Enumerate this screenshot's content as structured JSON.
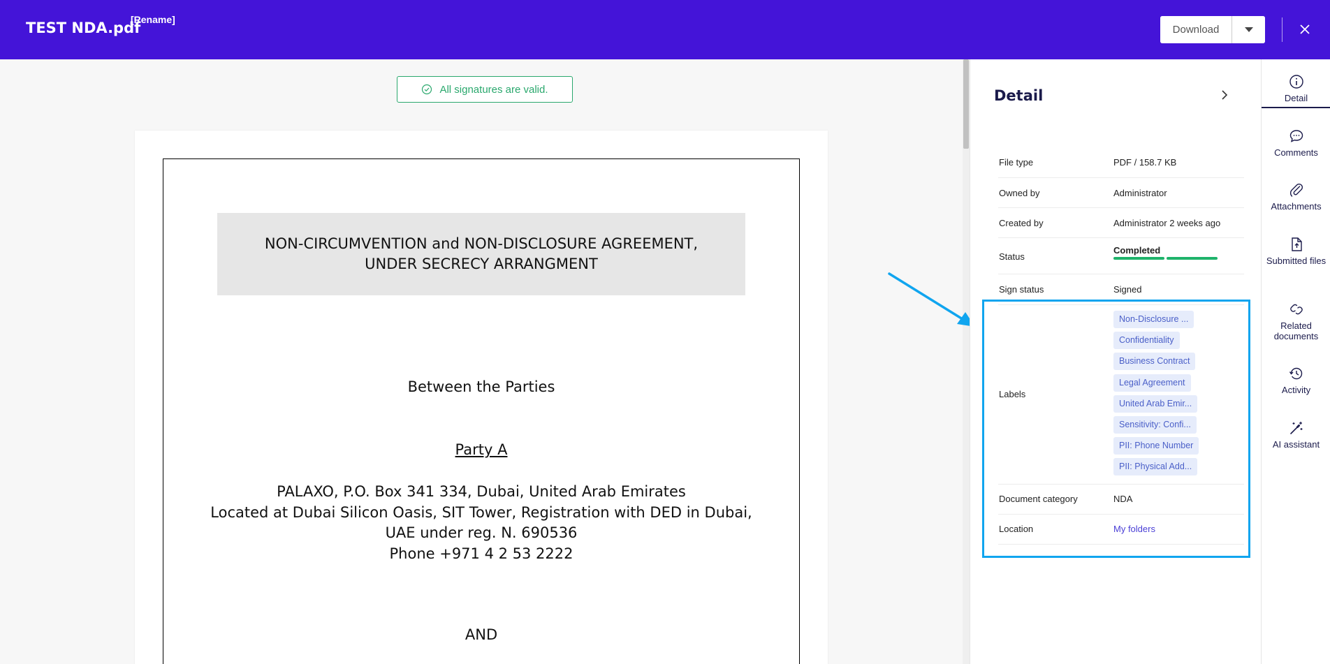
{
  "header": {
    "file_title": "TEST NDA.pdf",
    "rename_label": "[Rename]",
    "download_label": "Download"
  },
  "viewer": {
    "valid_badge": "All signatures are valid.",
    "document": {
      "title_line1": "NON-CIRCUMVENTION and NON-DISCLOSURE AGREEMENT,",
      "title_line2": "UNDER SECRECY ARRANGMENT",
      "between": "Between the Parties",
      "party_a": "Party A",
      "address_lines": [
        "PALAXO, P.O. Box 341 334, Dubai, United Arab Emirates",
        "Located at Dubai Silicon Oasis, SIT Tower, Registration with DED in Dubai,",
        "UAE under reg. N. 690536",
        "Phone  +971 4 2 53 2222"
      ],
      "and": "AND"
    }
  },
  "detail": {
    "title": "Detail",
    "rows": [
      {
        "key": "File type",
        "value": "PDF / 158.7 KB"
      },
      {
        "key": "Owned by",
        "value": "Administrator"
      },
      {
        "key": "Created by",
        "value": "Administrator 2 weeks ago"
      },
      {
        "key": "Status",
        "value": "Completed",
        "progress": 1.0
      },
      {
        "key": "Sign status",
        "value": "Signed"
      },
      {
        "key": "Labels"
      },
      {
        "key": "Document category",
        "value": "NDA"
      },
      {
        "key": "Location",
        "value": "My folders"
      }
    ],
    "labels": [
      "Non-Disclosure ...",
      "Confidentiality",
      "Business Contract",
      "Legal Agreement",
      "United Arab Emir...",
      "Sensitivity: Confi...",
      "PII: Phone Number",
      "PII: Physical Add..."
    ]
  },
  "rail": [
    {
      "label": "Detail",
      "icon": "info-icon"
    },
    {
      "label": "Comments",
      "icon": "comment-icon"
    },
    {
      "label": "Attachments",
      "icon": "paperclip-icon"
    },
    {
      "label": "Submitted files",
      "icon": "file-upload-icon"
    },
    {
      "label": "Related documents",
      "icon": "link-icon"
    },
    {
      "label": "Activity",
      "icon": "history-icon"
    },
    {
      "label": "AI assistant",
      "icon": "magic-wand-icon"
    }
  ],
  "colors": {
    "header_bg": "#4414d8",
    "valid_green": "#2aa86d",
    "highlight_blue": "#10a5ef",
    "label_chip_bg": "#e6ecfb",
    "status_bar": "#1fb36b"
  }
}
